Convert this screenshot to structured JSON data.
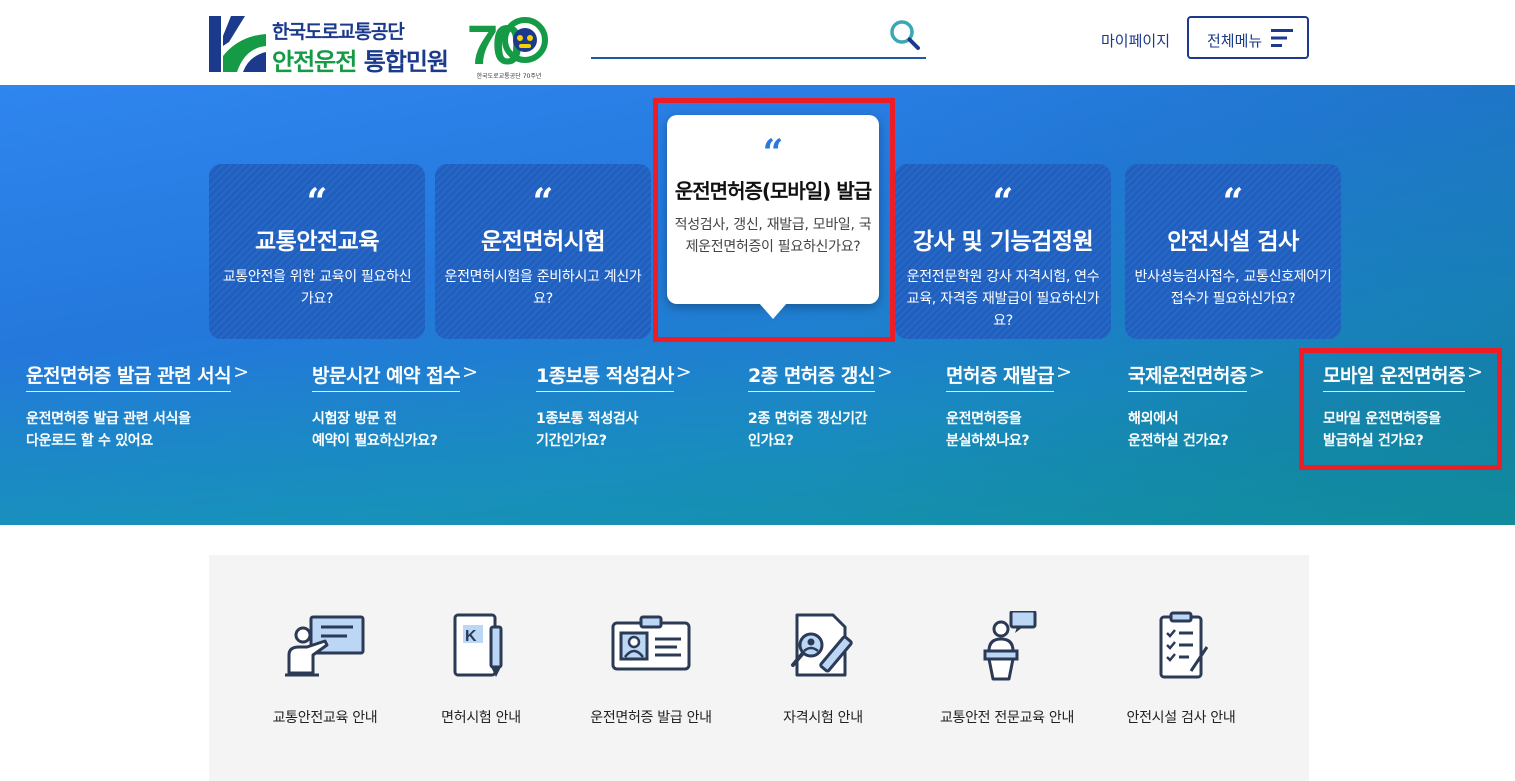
{
  "header": {
    "logo_line1": "한국도로교통공단",
    "logo_line2_green": "안전운전",
    "logo_line2_blue": "통합민원",
    "anniv_number": "70",
    "anniv_caption": "한국도로교통공단 70주년",
    "search": {
      "value": "",
      "placeholder": ""
    },
    "mypage_label": "마이페이지",
    "allmenu_label": "전체메뉴"
  },
  "cards": [
    {
      "title": "교통안전교육",
      "desc": "교통안전을 위한 교육이 필요하신가요?",
      "quote": "“"
    },
    {
      "title": "운전면허시험",
      "desc": "운전면허시험을 준비하시고 계신가요?",
      "quote": "“"
    },
    {
      "title": "운전면허증(모바일) 발급",
      "desc": "적성검사, 갱신, 재발급, 모바일, 국제운전면허증이 필요하신가요?",
      "quote": "“"
    },
    {
      "title": "강사 및 기능검정원",
      "desc": "운전전문학원 강사 자격시험, 연수교육, 자격증 재발급이 필요하신가요?",
      "quote": "“"
    },
    {
      "title": "안전시설 검사",
      "desc": "반사성능검사접수, 교통신호제어기 접수가 필요하신가요?",
      "quote": "“"
    }
  ],
  "sublinks": [
    {
      "title": "운전면허증 발급 관련 서식",
      "arrow": ">",
      "desc1": "운전면허증 발급 관련 서식을",
      "desc2": "다운로드 할 수 있어요"
    },
    {
      "title": "방문시간 예약 접수",
      "arrow": ">",
      "desc1": "시험장 방문 전",
      "desc2": "예약이 필요하신가요?"
    },
    {
      "title": "1종보통 적성검사",
      "arrow": ">",
      "desc1": "1종보통 적성검사",
      "desc2": "기간인가요?"
    },
    {
      "title": "2종 면허증 갱신",
      "arrow": ">",
      "desc1": "2종 면허증 갱신기간",
      "desc2": "인가요?"
    },
    {
      "title": "면허증 재발급",
      "arrow": ">",
      "desc1": "운전면허증을",
      "desc2": "분실하셨나요?"
    },
    {
      "title": "국제운전면허증",
      "arrow": ">",
      "desc1": "해외에서",
      "desc2": "운전하실 건가요?"
    },
    {
      "title": "모바일 운전면허증",
      "arrow": ">",
      "desc1": "모바일 운전면허증을",
      "desc2": "발급하실 건가요?"
    }
  ],
  "quick_links": [
    {
      "label": "교통안전교육 안내",
      "icon": "teacher-board-icon"
    },
    {
      "label": "면허시험 안내",
      "icon": "document-pen-icon"
    },
    {
      "label": "운전면허증 발급 안내",
      "icon": "id-card-icon"
    },
    {
      "label": "자격시험 안내",
      "icon": "exam-search-pen-icon"
    },
    {
      "label": "교통안전 전문교육 안내",
      "icon": "lecturer-podium-icon"
    },
    {
      "label": "안전시설 검사 안내",
      "icon": "clipboard-checklist-icon"
    }
  ],
  "colors": {
    "brand_blue": "#1b3a8c",
    "brand_green": "#159a46",
    "hero_blue": "#2478dc",
    "highlight_red": "#ee1c25"
  }
}
